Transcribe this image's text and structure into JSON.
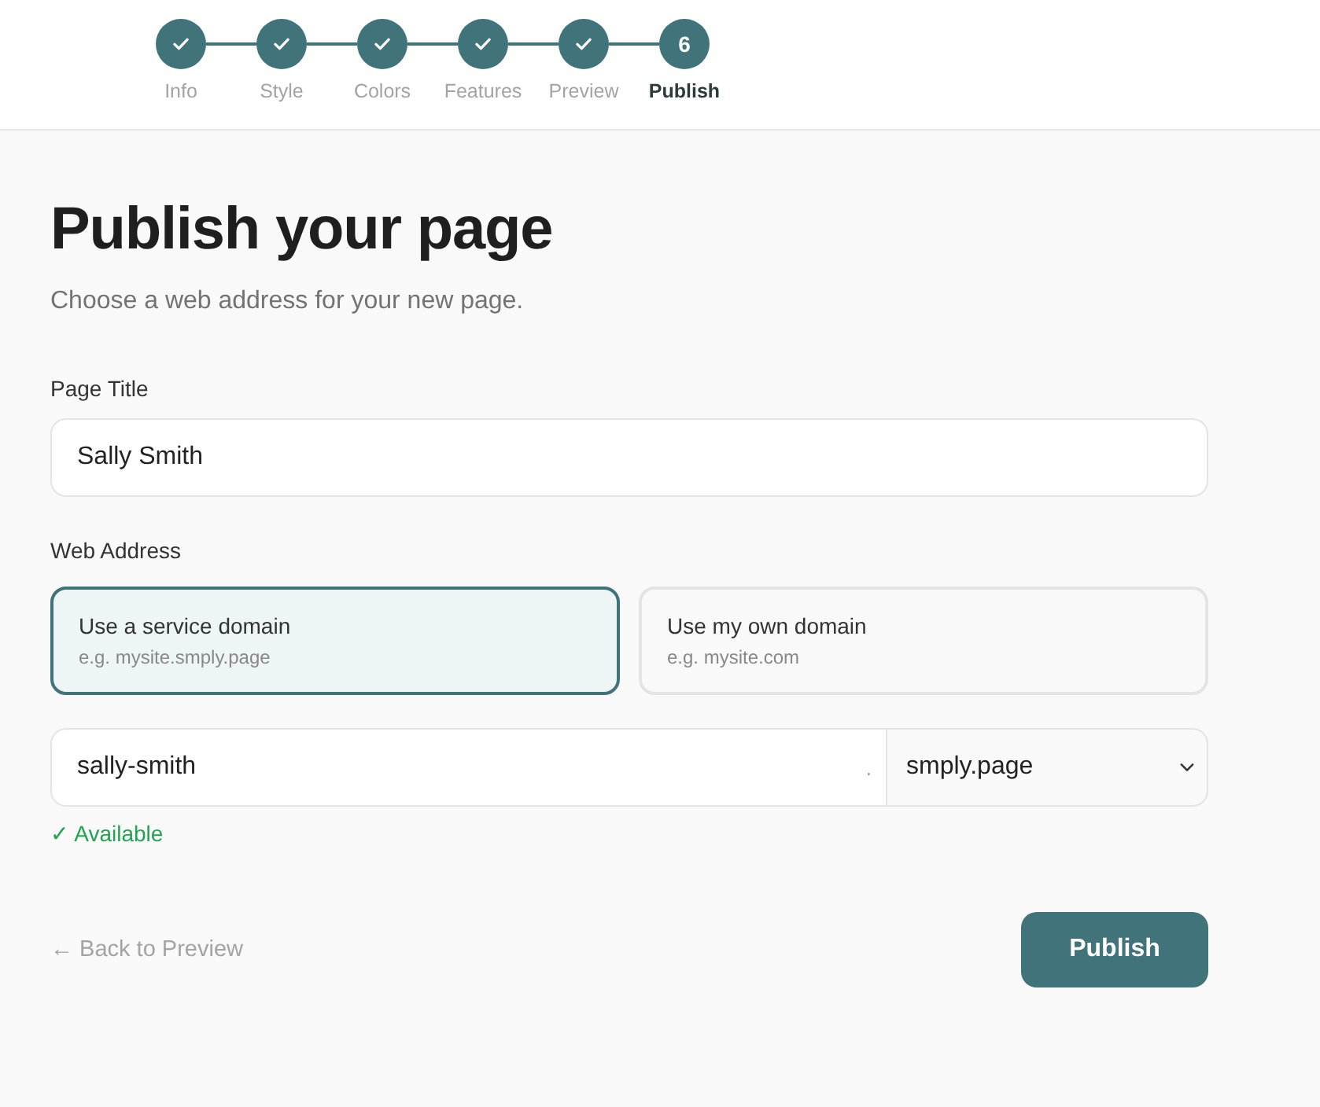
{
  "steps": [
    {
      "label": "Info",
      "completed": true,
      "selected": false
    },
    {
      "label": "Style",
      "completed": true,
      "selected": false
    },
    {
      "label": "Colors",
      "completed": true,
      "selected": false
    },
    {
      "label": "Features",
      "completed": true,
      "selected": false
    },
    {
      "label": "Preview",
      "completed": true,
      "selected": false
    },
    {
      "label": "Publish",
      "number": "6",
      "completed": false,
      "selected": true
    }
  ],
  "heading": "Publish your page",
  "subtitle": "Choose a web address for your new page.",
  "page_title_field": {
    "label": "Page Title",
    "value": "Sally Smith"
  },
  "web_address": {
    "label": "Web Address",
    "options": [
      {
        "title": "Use a service domain",
        "example": "e.g. mysite.smply.page",
        "selected": true
      },
      {
        "title": "Use my own domain",
        "example": "e.g. mysite.com",
        "selected": false
      }
    ],
    "subdomain": "sally-smith",
    "separator": ".",
    "domain": "smply.page",
    "status": {
      "text": "✓ Available",
      "kind": "success"
    }
  },
  "back_link": "← Back to Preview",
  "publish_button": "Publish"
}
